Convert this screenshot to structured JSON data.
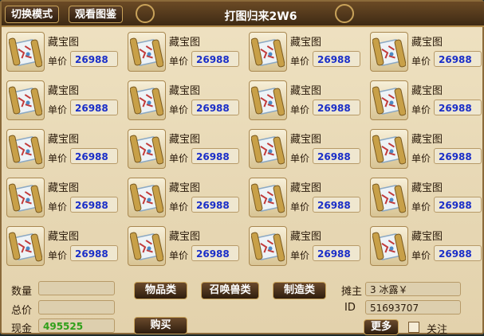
{
  "header": {
    "switch_mode_label": "切换模式",
    "view_catalog_label": "观看图鉴",
    "title": "打图归来2W6"
  },
  "items": [
    {
      "name": "藏宝图",
      "price_label": "单价",
      "price": "26988"
    },
    {
      "name": "藏宝图",
      "price_label": "单价",
      "price": "26988"
    },
    {
      "name": "藏宝图",
      "price_label": "单价",
      "price": "26988"
    },
    {
      "name": "藏宝图",
      "price_label": "单价",
      "price": "26988"
    },
    {
      "name": "藏宝图",
      "price_label": "单价",
      "price": "26988"
    },
    {
      "name": "藏宝图",
      "price_label": "单价",
      "price": "26988"
    },
    {
      "name": "藏宝图",
      "price_label": "单价",
      "price": "26988"
    },
    {
      "name": "藏宝图",
      "price_label": "单价",
      "price": "26988"
    },
    {
      "name": "藏宝图",
      "price_label": "单价",
      "price": "26988"
    },
    {
      "name": "藏宝图",
      "price_label": "单价",
      "price": "26988"
    },
    {
      "name": "藏宝图",
      "price_label": "单价",
      "price": "26988"
    },
    {
      "name": "藏宝图",
      "price_label": "单价",
      "price": "26988"
    },
    {
      "name": "藏宝图",
      "price_label": "单价",
      "price": "26988"
    },
    {
      "name": "藏宝图",
      "price_label": "单价",
      "price": "26988"
    },
    {
      "name": "藏宝图",
      "price_label": "单价",
      "price": "26988"
    },
    {
      "name": "藏宝图",
      "price_label": "单价",
      "price": "26988"
    },
    {
      "name": "藏宝图",
      "price_label": "单价",
      "price": "26988"
    },
    {
      "name": "藏宝图",
      "price_label": "单价",
      "price": "26988"
    },
    {
      "name": "藏宝图",
      "price_label": "单价",
      "price": "26988"
    },
    {
      "name": "藏宝图",
      "price_label": "单价",
      "price": "26988"
    }
  ],
  "bottom": {
    "quantity_label": "数量",
    "quantity_value": "",
    "total_label": "总价",
    "total_value": "",
    "cash_label": "现金",
    "cash_value": "495525",
    "tab_items_label": "物品类",
    "tab_summon_label": "召唤兽类",
    "tab_craft_label": "制造类",
    "buy_label": "购买",
    "owner_label": "摊主",
    "owner_value": "3 冰露￥",
    "id_label": "ID",
    "id_value": "51693707",
    "more_label": "更多",
    "follow_label": "关注"
  },
  "colors": {
    "price_text": "#1a2ec8",
    "cash_text": "#2fa01a",
    "button_border": "#c9a35a"
  },
  "icons": {
    "item": "treasure-map-scroll-icon"
  }
}
